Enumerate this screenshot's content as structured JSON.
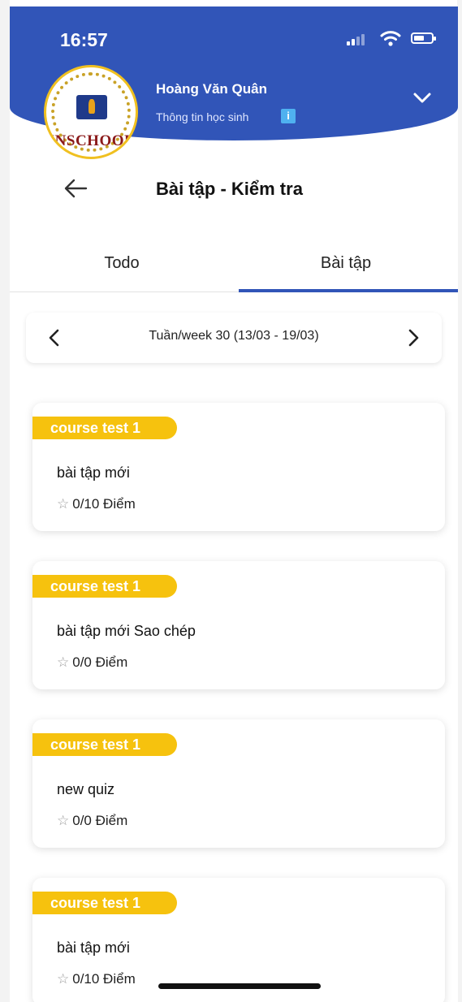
{
  "status_bar": {
    "time": "16:57"
  },
  "header": {
    "logo_text": "INSCHOOL",
    "user_name": "Hoàng Văn Quân",
    "user_subtitle": "Thông tin học sinh",
    "info_badge": "i"
  },
  "page": {
    "title": "Bài tập - Kiểm tra"
  },
  "tabs": [
    {
      "label": "Todo",
      "active": false
    },
    {
      "label": "Bài tập",
      "active": true
    }
  ],
  "week": {
    "label": "Tuần/week 30 (13/03 - 19/03)"
  },
  "assignments": [
    {
      "tag": "course test 1",
      "title": "bài tập mới",
      "score": "0/10 Điểm"
    },
    {
      "tag": "course test 1",
      "title": "bài tập mới Sao chép",
      "score": "0/0 Điểm"
    },
    {
      "tag": "course test 1",
      "title": "new quiz",
      "score": "0/0 Điểm"
    },
    {
      "tag": "course test 1",
      "title": "bài tập mới",
      "score": "0/10 Điểm"
    }
  ],
  "colors": {
    "primary": "#3155b8",
    "tag": "#f6c20e"
  }
}
